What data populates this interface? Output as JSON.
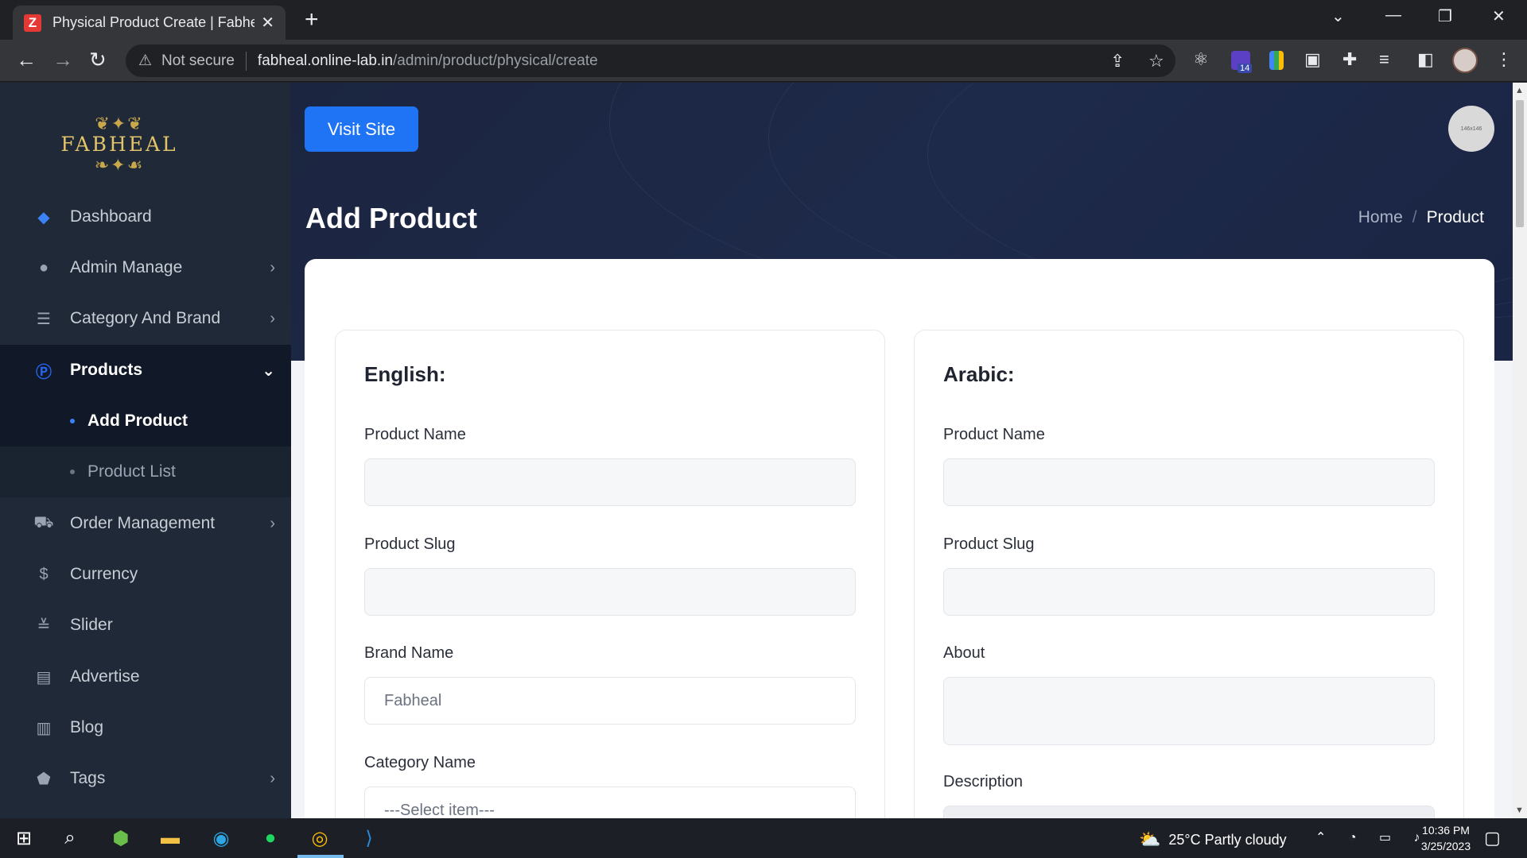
{
  "browser": {
    "tab_title": "Physical Product Create | Fabheal",
    "tab_favicon": "Z",
    "not_secure": "Not secure",
    "url_host": "fabheal.online-lab.in",
    "url_path": "/admin/product/physical/create",
    "extension_badge": "14"
  },
  "sidebar": {
    "logo_text": "FABHEAL",
    "items": [
      {
        "label": "Dashboard",
        "icon": "layers-icon"
      },
      {
        "label": "Admin Manage",
        "icon": "user-icon"
      },
      {
        "label": "Category And Brand",
        "icon": "list-icon"
      },
      {
        "label": "Products",
        "icon": "product-icon"
      },
      {
        "label": "Order Management",
        "icon": "cart-icon"
      },
      {
        "label": "Currency",
        "icon": "dollar-icon"
      },
      {
        "label": "Slider",
        "icon": "sliders-icon"
      },
      {
        "label": "Advertise",
        "icon": "ad-icon"
      },
      {
        "label": "Blog",
        "icon": "blog-icon"
      },
      {
        "label": "Tags",
        "icon": "tag-icon"
      }
    ],
    "sub_items": [
      {
        "label": "Add Product"
      },
      {
        "label": "Product List"
      }
    ]
  },
  "header": {
    "visit_site": "Visit Site",
    "avatar_text": "146x146",
    "page_title": "Add Product",
    "breadcrumb_home": "Home",
    "breadcrumb_sep": "/",
    "breadcrumb_current": "Product"
  },
  "english": {
    "title": "English:",
    "product_name_label": "Product Name",
    "product_slug_label": "Product Slug",
    "brand_name_label": "Brand Name",
    "brand_name_value": "Fabheal",
    "category_name_label": "Category Name",
    "category_select_value": "---Select item---"
  },
  "arabic": {
    "title": "Arabic:",
    "product_name_label": "Product Name",
    "product_slug_label": "Product Slug",
    "about_label": "About",
    "description_label": "Description"
  },
  "taskbar": {
    "weather": "25°C  Partly cloudy",
    "time": "10:36 PM",
    "date": "3/25/2023"
  },
  "colors": {
    "accent": "#1e74f5",
    "sidebar_bg": "#1f2937",
    "hero_bg": "#1b2540"
  }
}
